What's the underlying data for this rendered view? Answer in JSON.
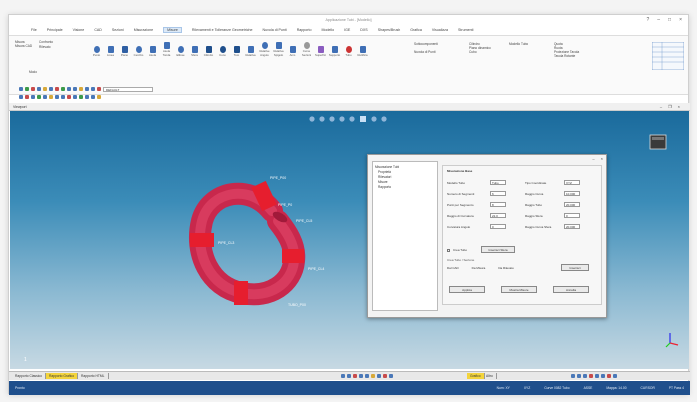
{
  "window": {
    "title": "Applicazione Tubi - [Modello]"
  },
  "menu": [
    "File",
    "Principale",
    "Visione",
    "CAD",
    "Sezioni",
    "Misurazione",
    "Misure",
    "Rilevamenti e Tolleranze Geometriche",
    "Nuvola di Punti",
    "Rapporto",
    "Modello",
    "IGE",
    "DXS",
    "Shapes/Brush",
    "Grafica",
    "Visualizza",
    "Strumenti"
  ],
  "menu_active_index": 6,
  "ribbon": {
    "group1": [
      "Misura",
      "Misura CAD",
      "Confronto",
      "Rilevato"
    ],
    "group_label": "Modo",
    "items": [
      "Punto",
      "Linea",
      "Piano",
      "Cerchio",
      "Asola",
      "Asola Tonda",
      "Ellisse",
      "Sfera",
      "Cilindro",
      "Cono",
      "Toro",
      "Relativa",
      "Relative Angolo",
      "Relativa Spigolo",
      "Arco",
      "Curve Sezioni",
      "Superfici",
      "Supporto",
      "Tubo",
      "Rettifica"
    ],
    "right1": [
      "Sottocomponenti",
      "Nuvola di Punti"
    ],
    "right2": [
      "Cilindro",
      "Piano dinamico",
      "Cubo",
      "Modello Tubo"
    ],
    "right3": [
      "Quota",
      "Ruota",
      "Proiezione Tavola",
      "Tavola Rotante"
    ]
  },
  "quickbar": {
    "combo": "DEFAULT"
  },
  "viewport": {
    "tab": "Viewport",
    "labels": [
      "PIPE_P00",
      "PIPE_P0",
      "PIPE_CL5",
      "PIPE_CL3",
      "PIPE_CL4",
      "TUBO_P00"
    ]
  },
  "dialog": {
    "tree": [
      "Misurazione Tubi",
      "Proprietà",
      "Rilevatori",
      "Misure",
      "Rapporto"
    ],
    "section": "Misurazione Base",
    "fields": [
      {
        "label": "Modello Tubo",
        "value": "Tubo"
      },
      {
        "label": "Numero di Segmenti",
        "value": "6"
      },
      {
        "label": "Punti per Segmento",
        "value": "8"
      },
      {
        "label": "Raggio di Curvatura",
        "value": "22.0"
      },
      {
        "label": "Curvatura Angolo",
        "value": "0"
      }
    ],
    "fields_right": [
      {
        "label": "Tipo Coordinate",
        "value": "XYZ"
      },
      {
        "label": "Raggio Curva",
        "value": "10.000"
      },
      {
        "label": "Raggio Tubo",
        "value": "20.000"
      },
      {
        "label": "Raggio Sfera",
        "value": "0"
      },
      {
        "label": "Raggio Curva Sfera",
        "value": "20.000"
      }
    ],
    "checks": [
      "Crea Tubo",
      "Inserisci Sfera",
      "Cilindri",
      "Piani"
    ],
    "buttons": [
      "Applica",
      "Mostra Misure",
      "Annulla"
    ],
    "radio_section": "Crea Tubo / Sezione",
    "radio": [
      "Dal CAD",
      "Da Misura",
      "Da Rilevato"
    ],
    "btn_right": "Inserisci"
  },
  "tabs": [
    "Rapporto Classico",
    "Rapporto Grafico",
    "Rapporto HTML"
  ],
  "tabs_right": [
    "Grafico",
    "Altro"
  ],
  "status": {
    "left": "Pronto",
    "right": [
      "Num: XY",
      "XYZ",
      "Curve 0082 Tubo",
      "ASSE",
      "Mappa: 14.00",
      "CURSOR",
      "PT Pass 4"
    ]
  }
}
